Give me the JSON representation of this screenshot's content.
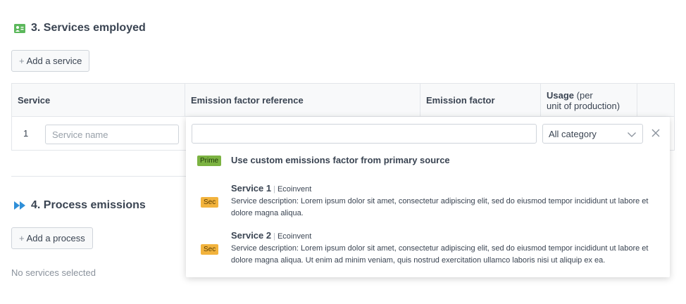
{
  "section3": {
    "title": "3. Services employed",
    "add_label": "Add a service"
  },
  "table": {
    "headers": {
      "service": "Service",
      "reference": "Emission factor reference",
      "factor": "Emission factor",
      "usage_bold": "Usage",
      "usage_light": " (per",
      "usage_line2": "unit of production)"
    },
    "row": {
      "num": "1",
      "service_placeholder": "Service name"
    }
  },
  "dropdown": {
    "search_value": "",
    "category": "All category",
    "custom": {
      "badge": "Prime",
      "label": "Use custom emissions factor from primary source"
    },
    "items": [
      {
        "badge": "Sec",
        "name": "Service 1",
        "separator": "|",
        "source": "Ecoinvent",
        "description": "Service description: Lorem ipsum dolor sit amet, consectetur adipiscing elit, sed do eiusmod tempor incididunt ut labore et dolore magna aliqua."
      },
      {
        "badge": "Sec",
        "name": "Service 2",
        "separator": "|",
        "source": "Ecoinvent",
        "description": "Service description: Lorem ipsum dolor sit amet, consectetur adipiscing elit, sed do eiusmod tempor incididunt ut labore et dolore magna aliqua. Ut enim ad minim veniam, quis nostrud exercitation ullamco laboris nisi ut aliquip ex ea."
      }
    ]
  },
  "section4": {
    "title": "4. Process emissions",
    "add_label": "Add a process",
    "empty_text": "No services selected"
  },
  "icons": {
    "plus": "+",
    "services": "id-card-icon",
    "process": "fast-forward-icon",
    "chevron": "chevron-down-icon",
    "close": "close-icon"
  },
  "colors": {
    "icon_green": "#5cb85c",
    "icon_blue": "#2f8fd8",
    "prime": "#7cb342",
    "sec": "#f2b33d"
  }
}
